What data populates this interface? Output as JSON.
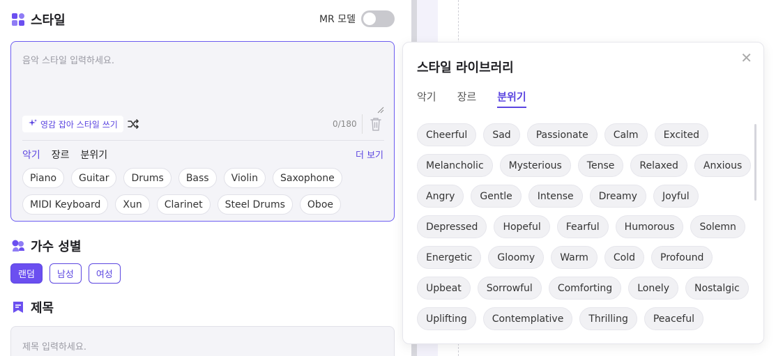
{
  "style_section": {
    "title": "스타일",
    "mr_label": "MR 모델",
    "mr_enabled": false,
    "placeholder": "음악 스타일 입력하세요.",
    "inspire_label": "영감 잡아 스타일 쓰기",
    "counter": "0/180",
    "tabs": [
      "악기",
      "장르",
      "분위기"
    ],
    "active_tab": "악기",
    "more_label": "더 보기",
    "instruments_row1": [
      "Piano",
      "Guitar",
      "Drums",
      "Bass",
      "Violin",
      "Saxophone"
    ],
    "instruments_row2": [
      "MIDI Keyboard",
      "Xun",
      "Clarinet",
      "Steel Drums",
      "Oboe"
    ]
  },
  "singer_section": {
    "title": "가수 성별",
    "options": [
      "랜덤",
      "남성",
      "여성"
    ],
    "selected": "랜덤"
  },
  "title_section": {
    "title": "제목",
    "placeholder": "제목 입력하세요."
  },
  "library": {
    "title": "스타일 라이브러리",
    "close_icon": "close-icon",
    "tabs": [
      "악기",
      "장르",
      "분위기"
    ],
    "active_tab": "분위기",
    "moods": [
      [
        "Cheerful",
        "Sad",
        "Passionate",
        "Calm",
        "Excited"
      ],
      [
        "Melancholic",
        "Mysterious",
        "Tense",
        "Relaxed",
        "Anxious"
      ],
      [
        "Angry",
        "Gentle",
        "Intense",
        "Dreamy",
        "Joyful"
      ],
      [
        "Depressed",
        "Hopeful",
        "Fearful",
        "Humorous",
        "Solemn"
      ],
      [
        "Energetic",
        "Gloomy",
        "Warm",
        "Cold",
        "Profound"
      ],
      [
        "Upbeat",
        "Sorrowful",
        "Comforting",
        "Lonely",
        "Nostalgic"
      ],
      [
        "Uplifting",
        "Contemplative",
        "Thrilling",
        "Peaceful"
      ]
    ]
  },
  "colors": {
    "accent": "#5b45e0",
    "accent_fill": "#6b4ff0"
  }
}
